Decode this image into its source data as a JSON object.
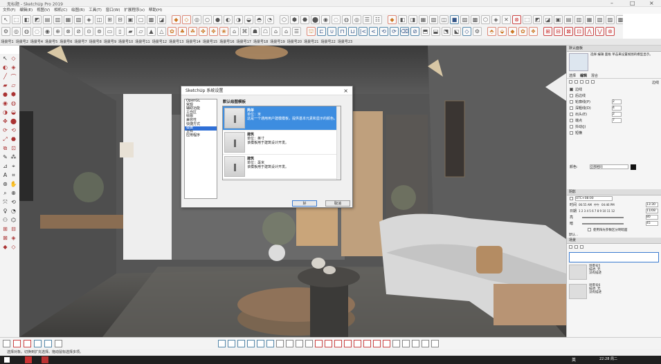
{
  "window": {
    "title": "无标题 - SketchUp Pro 2019",
    "title_short": "无标题 - SketchUp Pro 2019"
  },
  "menu": [
    "文件(F)",
    "编辑(E)",
    "视图(V)",
    "相机(C)",
    "绘图(R)",
    "工具(T)",
    "窗口(W)",
    "扩展程序(x)",
    "帮助(H)"
  ],
  "scene_tabs": [
    "场景号1",
    "场景号2",
    "场景号4",
    "场景号5",
    "场景号6",
    "场景号7",
    "场景号8",
    "场景号9",
    "场景号10",
    "场景号11",
    "场景号12",
    "场景号13",
    "场景号14",
    "场景号15",
    "场景号16",
    "场景号17",
    "场景号18",
    "场景号19",
    "场景号20",
    "场景号21",
    "场景号22",
    "场景号23"
  ],
  "dialog": {
    "title": "SketchUp 系统设置",
    "close": "×",
    "categories": [
      "OpenGL",
      "常规",
      "辅助功能",
      "工作区",
      "绘图",
      "兼容性",
      "快捷方式",
      "模板",
      "文件",
      "应用程序"
    ],
    "selected_category": "模板",
    "section_title": "默认绘图模板",
    "templates": [
      {
        "name": "简单",
        "unit": "单位：米",
        "desc": "这是一个通用用户建模模板，提供基本元素和显示的颜色。"
      },
      {
        "name": "建筑",
        "unit": "单位：英寸",
        "desc": "该模板用于建筑设计开发。"
      },
      {
        "name": "建筑",
        "unit": "单位：毫米",
        "desc": "该模板用于建筑设计开发。"
      }
    ],
    "ok": "好",
    "cancel": "取消"
  },
  "right_panel": {
    "tray_title": "默认面板",
    "instructor_text": "选择 编辑 面板 单击来设置视图的模型显示。",
    "tabs": [
      "选择",
      "编辑",
      "混合"
    ],
    "edge_label": "边线",
    "edges": {
      "label": "边线",
      "checked": true
    },
    "back_edges": "后边线",
    "profiles": {
      "label": "轮廓线(P)",
      "value": "2"
    },
    "depth_cue": {
      "label": "深粗线(D)",
      "value": "4"
    },
    "extension": {
      "label": "出头(E)",
      "value": "2"
    },
    "endpoints": {
      "label": "端点",
      "value": "7"
    },
    "jitter": "抖动(J)",
    "halo": "短横",
    "color_label": "颜色:",
    "color_value": "全部相同",
    "shadows_header": "阴影",
    "utc": "UTC+08:00",
    "time_label": "时间",
    "time_start": "06:55 AM",
    "time_noon": "中午",
    "time_end": "04:46 PM",
    "time_value": "13:30",
    "date_label": "日期",
    "months": "1 2 3 4 5 6 7 8 9 10 11 12",
    "date_value": "11/08",
    "light_label": "亮",
    "light_value": "80",
    "dark_label": "暗",
    "dark_value": "45",
    "sun_shading": "使用阳光参数区分明暗面",
    "scenes_header": "场景",
    "scenes_tray_label": "默认...",
    "scene_items": [
      {
        "name": "场景号5",
        "desc": "描述: 无",
        "note": "没有描述"
      },
      {
        "name": "场景号6",
        "desc": "描述: 无",
        "note": "没有描述"
      }
    ]
  },
  "statusbar": {
    "hint": "选择对象。切换到扩充选择。拖动鼠标选择多项。"
  },
  "taskbar": {
    "time": "22:28 周二",
    "lang": "英"
  },
  "colors": {
    "dialog_sel": "#2f6fd6",
    "template_sel": "#3d8de0",
    "viewport_wall": "#5b5b5b"
  }
}
